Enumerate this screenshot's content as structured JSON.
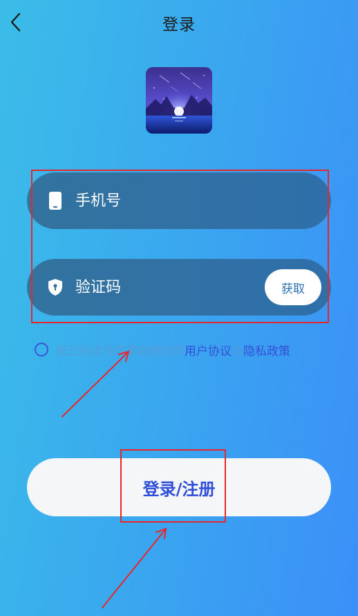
{
  "header": {
    "title": "登录",
    "back_icon": "chevron-left-icon"
  },
  "app_icon": {
    "icon": "app-logo-night-sky"
  },
  "form": {
    "phone": {
      "placeholder": "手机号",
      "icon": "phone-icon"
    },
    "code": {
      "placeholder": "验证码",
      "icon": "shield-icon",
      "get_button": "获取"
    }
  },
  "agreement": {
    "prefix": "我已阅读并同意助眠伙伴",
    "user_agreement": "用户协议",
    "and": "与",
    "privacy_policy": "隐私政策"
  },
  "login_button": {
    "label": "登录/注册"
  },
  "colors": {
    "accent": "#2f4fd8",
    "annotation": "#e8262a"
  }
}
